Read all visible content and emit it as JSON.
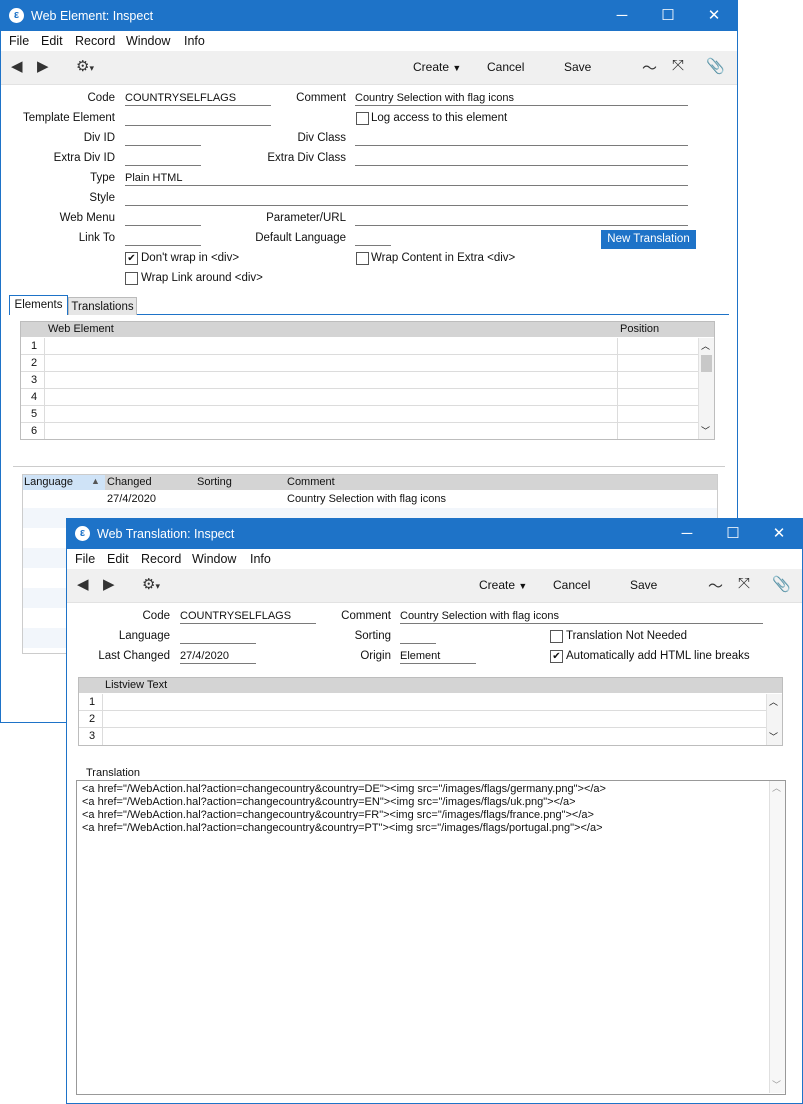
{
  "main_window": {
    "title": "Web Element: Inspect",
    "menu": [
      "File",
      "Edit",
      "Record",
      "Window",
      "Info"
    ],
    "toolbar": {
      "create": "Create",
      "cancel": "Cancel",
      "save": "Save"
    },
    "form": {
      "code_label": "Code",
      "code_value": "COUNTRYSELFLAGS",
      "comment_label": "Comment",
      "comment_value": "Country Selection with flag icons",
      "template_label": "Template Element",
      "template_value": "",
      "log_access_label": "Log access to this element",
      "divid_label": "Div ID",
      "divclass_label": "Div Class",
      "extradivid_label": "Extra Div ID",
      "extradivclass_label": "Extra Div Class",
      "type_label": "Type",
      "type_value": "Plain HTML",
      "style_label": "Style",
      "webmenu_label": "Web Menu",
      "param_label": "Parameter/URL",
      "linkto_label": "Link To",
      "deflang_label": "Default Language",
      "new_translation": "New Translation",
      "dont_wrap_label": "Don't wrap in <div>",
      "wrap_content_label": "Wrap Content in Extra <div>",
      "wrap_link_label": "Wrap Link around <div>"
    },
    "tabs": [
      "Elements",
      "Translations"
    ],
    "elements_grid": {
      "columns": [
        "Web Element",
        "Position"
      ],
      "rows": [
        "1",
        "2",
        "3",
        "4",
        "5",
        "6"
      ]
    },
    "translations_list": {
      "columns": [
        "Language",
        "Changed",
        "Sorting",
        "Comment"
      ],
      "rows": [
        {
          "language": "",
          "changed": "27/4/2020",
          "sorting": "",
          "comment": "Country Selection with flag icons"
        }
      ]
    }
  },
  "translation_window": {
    "title": "Web Translation: Inspect",
    "menu": [
      "File",
      "Edit",
      "Record",
      "Window",
      "Info"
    ],
    "toolbar": {
      "create": "Create",
      "cancel": "Cancel",
      "save": "Save"
    },
    "form": {
      "code_label": "Code",
      "code_value": "COUNTRYSELFLAGS",
      "comment_label": "Comment",
      "comment_value": "Country Selection with flag icons",
      "language_label": "Language",
      "language_value": "",
      "sorting_label": "Sorting",
      "sorting_value": "",
      "not_needed_label": "Translation Not Needed",
      "lastchanged_label": "Last Changed",
      "lastchanged_value": "27/4/2020",
      "origin_label": "Origin",
      "origin_value": "Element",
      "auto_br_label": "Automatically add HTML line breaks"
    },
    "listview": {
      "header": "Listview Text",
      "rows": [
        "1",
        "2",
        "3"
      ]
    },
    "translation_label": "Translation",
    "translation_text": "<a href=\"/WebAction.hal?action=changecountry&country=DE\"><img src=\"/images/flags/germany.png\"></a>\n<a href=\"/WebAction.hal?action=changecountry&country=EN\"><img src=\"/images/flags/uk.png\"></a>\n<a href=\"/WebAction.hal?action=changecountry&country=FR\"><img src=\"/images/flags/france.png\"></a>\n<a href=\"/WebAction.hal?action=changecountry&country=PT\"><img src=\"/images/flags/portugal.png\"></a>"
  }
}
